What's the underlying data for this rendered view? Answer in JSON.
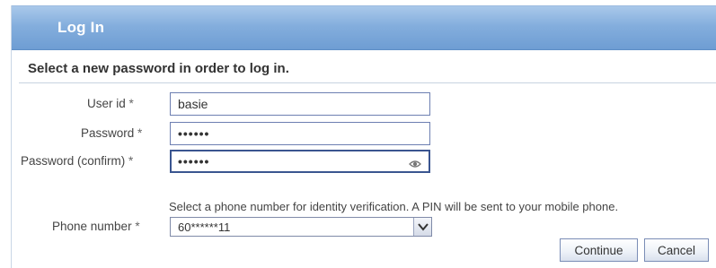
{
  "dialog": {
    "title": "Log In",
    "intro": "Select a new password in order to log in."
  },
  "form": {
    "required_marker": "*",
    "user_id": {
      "label": "User id",
      "value": "basie"
    },
    "password": {
      "label": "Password",
      "value": "••••••"
    },
    "password_confirm": {
      "label": "Password (confirm)",
      "value": "••••••"
    },
    "phone_note": "Select a phone number for identity verification. A PIN will be sent to your mobile phone.",
    "phone_number": {
      "label": "Phone number",
      "selected": "60******11"
    }
  },
  "buttons": {
    "continue": "Continue",
    "cancel": "Cancel"
  },
  "colors": {
    "titlebar": "#84aedd",
    "field_border": "#6d7fb1",
    "button_border": "#7a8db6"
  },
  "icons": {
    "password_field": "password-reveal-icon",
    "phone_select": "chevron-down-icon"
  }
}
